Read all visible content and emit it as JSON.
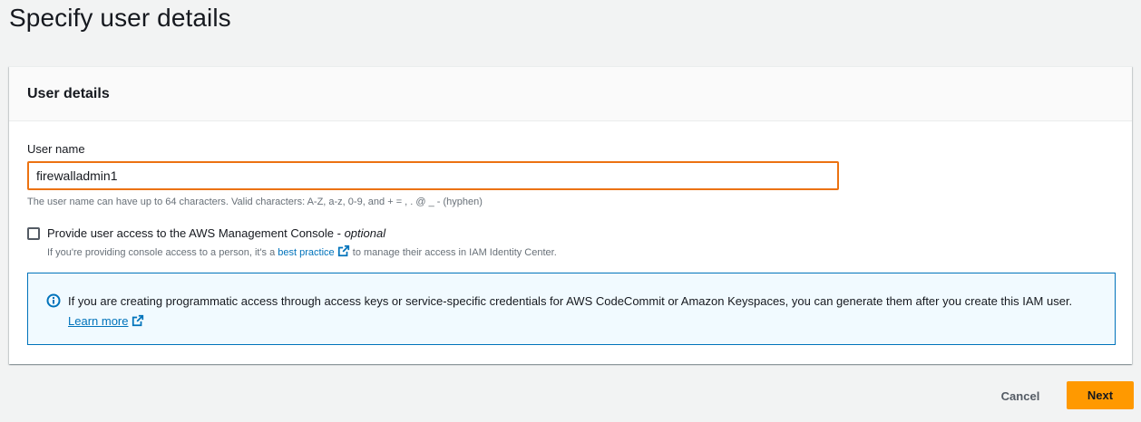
{
  "page": {
    "title": "Specify user details"
  },
  "panel": {
    "header": "User details",
    "username": {
      "label": "User name",
      "value": "firewalladmin1",
      "hint": "The user name can have up to 64 characters. Valid characters: A-Z, a-z, 0-9, and + = , . @ _ - (hyphen)"
    },
    "console_access": {
      "checked": false,
      "label": "Provide user access to the AWS Management Console - ",
      "optional": "optional",
      "desc_before": "If you're providing console access to a person, it's a ",
      "desc_link": "best practice",
      "desc_after": " to manage their access in IAM Identity Center."
    },
    "info": {
      "text": "If you are creating programmatic access through access keys or service-specific credentials for AWS CodeCommit or Amazon Keyspaces, you can generate them after you create this IAM user. ",
      "link": "Learn more"
    }
  },
  "actions": {
    "cancel": "Cancel",
    "next": "Next"
  },
  "colors": {
    "accent": "#ff9900",
    "input_focus": "#ec7211",
    "link": "#0073bb",
    "info_bg": "#f1faff"
  },
  "icons": {
    "external": "external-link-icon",
    "info": "info-icon"
  }
}
